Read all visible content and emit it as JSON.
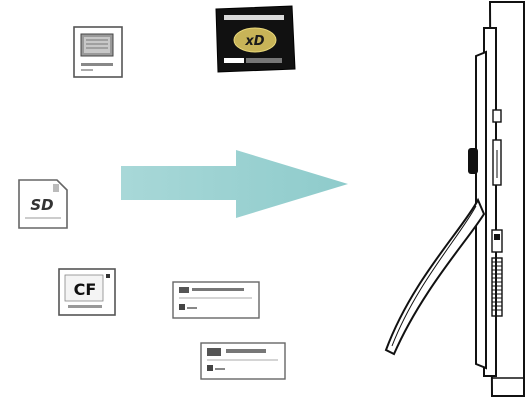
{
  "memory_cards": [
    {
      "id": "memory-stick",
      "icon": "memory-stick-card-icon",
      "label": ""
    },
    {
      "id": "xd-picture-card",
      "icon": "xd-picture-card-icon",
      "label": "xD"
    },
    {
      "id": "sd-card",
      "icon": "sd-card-icon",
      "label": "SD"
    },
    {
      "id": "compact-flash",
      "icon": "compact-flash-card-icon",
      "label": "CF"
    },
    {
      "id": "memory-stick-pro",
      "icon": "memory-stick-pro-card-icon",
      "label": ""
    },
    {
      "id": "memory-stick-duo",
      "icon": "memory-stick-duo-card-icon",
      "label": ""
    }
  ],
  "arrow": {
    "icon": "insert-arrow-icon",
    "color": "#9ad2d2"
  },
  "device": {
    "icon": "photo-frame-side-view-icon"
  }
}
